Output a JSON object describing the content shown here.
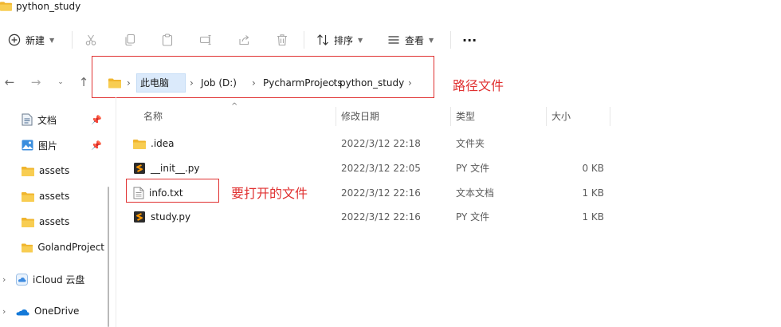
{
  "window": {
    "title": "python_study"
  },
  "toolbar": {
    "new_label": "新建",
    "sort_label": "排序",
    "view_label": "查看",
    "more_label": "···"
  },
  "address": {
    "crumbs": [
      "此电脑",
      "Job (D:)",
      "PycharmProjects",
      "python_study"
    ],
    "annotation": "路径文件"
  },
  "sidebar": {
    "items": [
      {
        "label": "文档",
        "icon": "document-icon",
        "pinned": true
      },
      {
        "label": "图片",
        "icon": "picture-icon",
        "pinned": true
      },
      {
        "label": "assets",
        "icon": "folder-icon"
      },
      {
        "label": "assets",
        "icon": "folder-icon"
      },
      {
        "label": "assets",
        "icon": "folder-icon"
      },
      {
        "label": "GolandProject",
        "icon": "folder-icon"
      },
      {
        "label": "iCloud 云盘",
        "icon": "icloud-icon",
        "expandable": true
      },
      {
        "label": "OneDrive",
        "icon": "onedrive-icon",
        "expandable": true
      }
    ]
  },
  "columns": {
    "name": "名称",
    "modified": "修改日期",
    "type": "类型",
    "size": "大小"
  },
  "files": [
    {
      "name": ".idea",
      "modified": "2022/3/12 22:18",
      "type": "文件夹",
      "size": "",
      "icon": "folder-icon"
    },
    {
      "name": "__init__.py",
      "modified": "2022/3/12 22:05",
      "type": "PY 文件",
      "size": "0 KB",
      "icon": "python-file-icon"
    },
    {
      "name": "info.txt",
      "modified": "2022/3/12 22:16",
      "type": "文本文档",
      "size": "1 KB",
      "icon": "text-file-icon"
    },
    {
      "name": "study.py",
      "modified": "2022/3/12 22:16",
      "type": "PY 文件",
      "size": "1 KB",
      "icon": "python-file-icon"
    }
  ],
  "file_annotation": "要打开的文件",
  "colors": {
    "annotation_red": "#e03131",
    "folder_yellow": "#f6c244",
    "selection_blue": "#dbeafb"
  }
}
